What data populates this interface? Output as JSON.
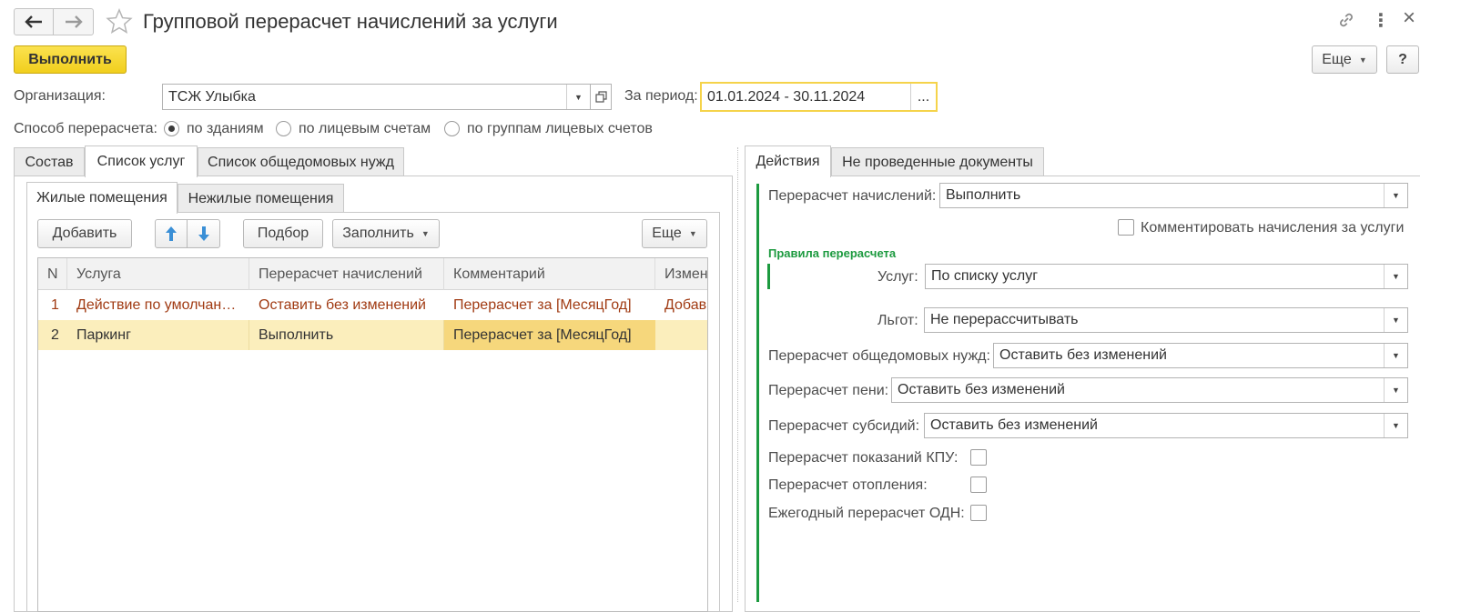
{
  "window": {
    "title": "Групповой перерасчет начислений за услуги",
    "more_icon": "⋮",
    "close_icon": "×"
  },
  "toolbar": {
    "execute_label": "Выполнить",
    "more_label": "Еще",
    "help_label": "?"
  },
  "form": {
    "org_label": "Организация:",
    "org_value": "ТСЖ Улыбка",
    "period_label": "За период:",
    "period_value": "01.01.2024 - 30.11.2024",
    "period_btn": "...",
    "method_label": "Способ перерасчета:",
    "method_options": [
      "по зданиям",
      "по лицевым счетам",
      "по группам лицевых счетов"
    ],
    "method_selected": 0
  },
  "left_tabs": [
    "Состав",
    "Список услуг",
    "Список общедомовых нужд"
  ],
  "left_active_tab": 1,
  "sub_tabs": [
    "Жилые помещения",
    "Нежилые помещения"
  ],
  "sub_active_tab": 0,
  "table_toolbar": {
    "add_label": "Добавить",
    "pick_label": "Подбор",
    "fill_label": "Заполнить",
    "more_label": "Еще"
  },
  "table": {
    "columns": [
      "N",
      "Услуга",
      "Перерасчет начислений",
      "Комментарий",
      "Измен"
    ],
    "rows": [
      {
        "n": "1",
        "service": "Действие по умолчан…",
        "recalc": "Оставить без изменений",
        "comment": "Перерасчет за [МесяцГод]",
        "change": "Добав"
      },
      {
        "n": "2",
        "service": "Паркинг",
        "recalc": "Выполнить",
        "comment": "Перерасчет за [МесяцГод]",
        "change": ""
      }
    ]
  },
  "right_tabs": [
    "Действия",
    "Не проведенные документы"
  ],
  "right_active_tab": 0,
  "actions": {
    "recalc_label": "Перерасчет начислений:",
    "recalc_value": "Выполнить",
    "comment_check_label": "Комментировать начисления за услуги",
    "rules_header": "Правила перерасчета",
    "services_label": "Услуг:",
    "services_value": "По списку услуг",
    "benefits_label": "Льгот:",
    "benefits_value": "Не перерассчитывать",
    "common_label": "Перерасчет общедомовых нужд:",
    "common_value": "Оставить без изменений",
    "penalty_label": "Перерасчет пени:",
    "penalty_value": "Оставить без изменений",
    "subsidy_label": "Перерасчет субсидий:",
    "subsidy_value": "Оставить без изменений",
    "kpu_label": "Перерасчет показаний КПУ:",
    "heating_label": "Перерасчет отопления:",
    "odn_label": "Ежегодный перерасчет ОДН:"
  },
  "colors": {
    "accent_yellow": "#f7d631",
    "highlight_row": "#fbeebc",
    "highlight_cell": "#f6d77c",
    "row_text_red": "#a03a12",
    "green": "#1c9a3f",
    "arrow_blue": "#3a8fd6"
  }
}
